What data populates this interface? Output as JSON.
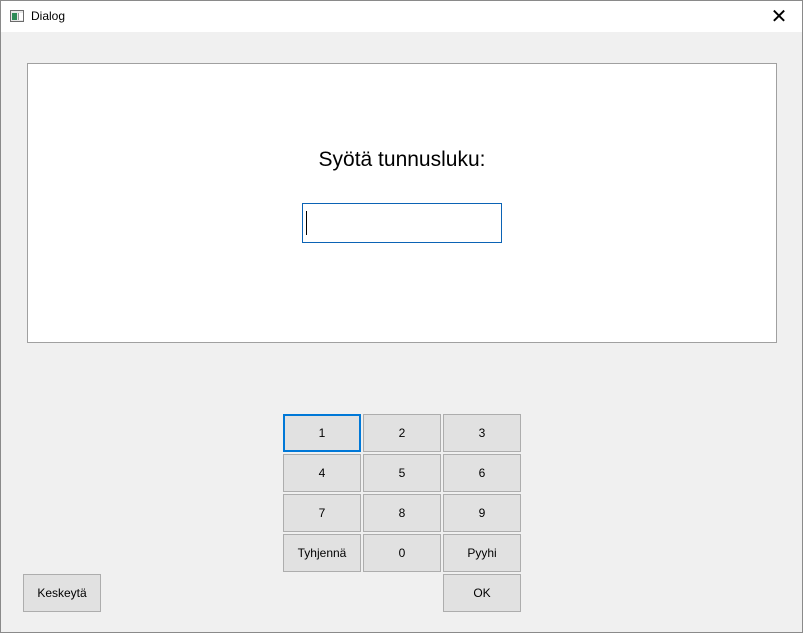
{
  "window": {
    "title": "Dialog",
    "close_glyph": "✕"
  },
  "dialog": {
    "prompt": "Syötä tunnusluku:",
    "pin_value": ""
  },
  "keypad": {
    "k1": "1",
    "k2": "2",
    "k3": "3",
    "k4": "4",
    "k5": "5",
    "k6": "6",
    "k7": "7",
    "k8": "8",
    "k9": "9",
    "clear": "Tyhjennä",
    "k0": "0",
    "backspace": "Pyyhi",
    "ok": "OK"
  },
  "actions": {
    "cancel": "Keskeytä"
  },
  "colors": {
    "focus_accent": "#0078d7",
    "input_border": "#0b63b5",
    "button_bg": "#e1e1e1"
  }
}
